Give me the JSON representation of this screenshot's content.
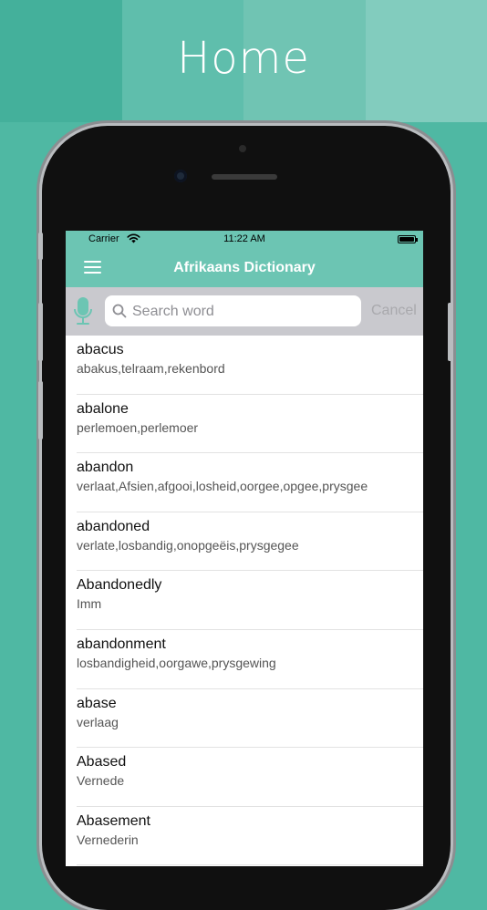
{
  "banner": {
    "title": "Home",
    "strip_colors": [
      "#44b09b",
      "#5fbeac",
      "#70c4b3",
      "#82ccbe"
    ]
  },
  "status_bar": {
    "carrier": "Carrier",
    "time": "11:22 AM"
  },
  "navbar": {
    "title": "Afrikaans Dictionary"
  },
  "search": {
    "placeholder": "Search word",
    "value": "",
    "cancel_label": "Cancel"
  },
  "words": [
    {
      "word": "abacus",
      "meaning": "abakus,telraam,rekenbord"
    },
    {
      "word": "abalone",
      "meaning": "perlemoen,perlemoer"
    },
    {
      "word": "abandon",
      "meaning": "verlaat,Afsien,afgooi,losheid,oorgee,opgee,prysgee"
    },
    {
      "word": "abandoned",
      "meaning": "verlate,losbandig,onopgeëis,prysgegee"
    },
    {
      "word": "Abandonedly",
      "meaning": "Imm"
    },
    {
      "word": "abandonment",
      "meaning": "losbandigheid,oorgawe,prysgewing"
    },
    {
      "word": "abase",
      "meaning": "verlaag"
    },
    {
      "word": "Abased",
      "meaning": "Vernede"
    },
    {
      "word": "Abasement",
      "meaning": "Vernederin"
    }
  ],
  "colors": {
    "background": "#4fb8a3",
    "accent": "#6cc5b3",
    "searchbar_bg": "#c9c9ce"
  },
  "icons": {
    "menu": "hamburger-menu-icon",
    "mic": "microphone-icon",
    "search": "magnifier-icon",
    "wifi": "wifi-icon",
    "battery": "battery-icon"
  }
}
